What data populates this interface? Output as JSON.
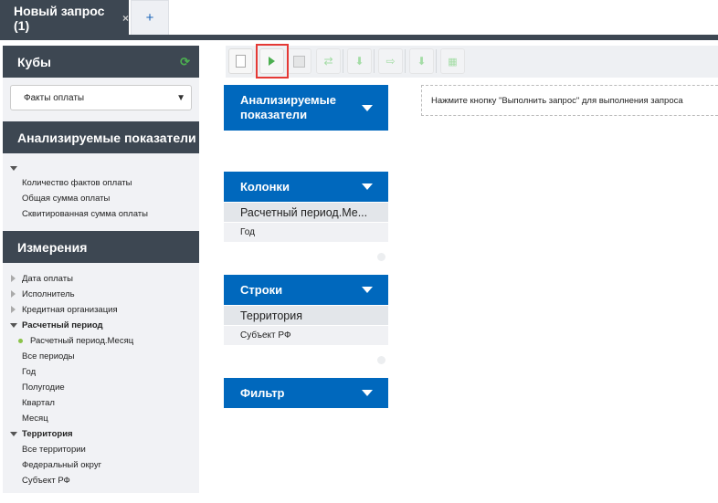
{
  "tabs": {
    "active": "Новый запрос (1)",
    "close": "×",
    "add": "+"
  },
  "left": {
    "cubes_title": "Кубы",
    "cube_selected": "Факты оплаты",
    "measures_title": "Анализируемые показатели",
    "measures": [
      "Количество фактов оплаты",
      "Общая сумма оплаты",
      "Сквитированная сумма оплаты"
    ],
    "dimensions_title": "Измерения",
    "dimensions": [
      {
        "label": "Дата оплаты",
        "type": "collapsed"
      },
      {
        "label": "Исполнитель",
        "type": "collapsed"
      },
      {
        "label": "Кредитная организация",
        "type": "collapsed"
      },
      {
        "label": "Расчетный период",
        "type": "expanded"
      },
      {
        "label": "Расчетный период.Месяц",
        "type": "hierarchy"
      },
      {
        "label": "Все периоды",
        "type": "level"
      },
      {
        "label": "Год",
        "type": "level"
      },
      {
        "label": "Полугодие",
        "type": "level"
      },
      {
        "label": "Квартал",
        "type": "level"
      },
      {
        "label": "Месяц",
        "type": "level"
      },
      {
        "label": "Территория",
        "type": "expanded"
      },
      {
        "label": "Все территории",
        "type": "level"
      },
      {
        "label": "Федеральный округ",
        "type": "level"
      },
      {
        "label": "Субъект РФ",
        "type": "level"
      }
    ]
  },
  "main": {
    "measures_title": "Анализируемые показатели",
    "columns_title": "Колонки",
    "columns_hierarchy": "Расчетный период.Ме...",
    "columns_level": "Год",
    "rows_title": "Строки",
    "rows_hierarchy": "Территория",
    "rows_level": "Субъект РФ",
    "filter_title": "Фильтр",
    "message": "Нажмите кнопку \"Выполнить запрос\" для выполнения запроса"
  },
  "colors": {
    "dark": "#3d4752",
    "blue": "#0068bd",
    "highlight": "#e53935"
  }
}
